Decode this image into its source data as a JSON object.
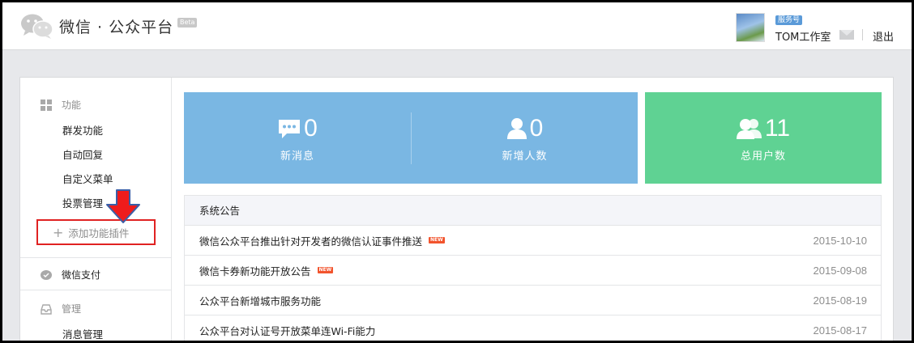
{
  "header": {
    "logo_text": "微信 · 公众平台",
    "beta_label": "Beta",
    "account_badge": "服务号",
    "account_name": "TOM工作室",
    "logout_label": "退出"
  },
  "sidebar": {
    "sections": [
      {
        "label": "功能",
        "icon": "grid-icon"
      },
      {
        "label": "微信支付",
        "icon": "wechat-pay-icon"
      },
      {
        "label": "管理",
        "icon": "inbox-icon"
      }
    ],
    "function_items": [
      "群发功能",
      "自动回复",
      "自定义菜单",
      "投票管理"
    ],
    "add_plugin_label": "添加功能插件",
    "manage_items": [
      "消息管理"
    ]
  },
  "stats": [
    {
      "value": "0",
      "label": "新消息",
      "icon": "message-icon"
    },
    {
      "value": "0",
      "label": "新增人数",
      "icon": "user-icon"
    },
    {
      "value": "11",
      "label": "总用户数",
      "icon": "users-icon"
    }
  ],
  "colors": {
    "stat_blue": "#7ab7e3",
    "stat_green": "#5fd293",
    "highlight_red": "#e02222",
    "new_badge": "#f2542d"
  },
  "notices": {
    "title": "系统公告",
    "items": [
      {
        "title": "微信公众平台推出针对开发者的微信认证事件推送",
        "is_new": true,
        "new_label": "NEW",
        "date": "2015-10-10"
      },
      {
        "title": "微信卡券新功能开放公告",
        "is_new": true,
        "new_label": "NEW",
        "date": "2015-09-08"
      },
      {
        "title": "公众平台新增城市服务功能",
        "is_new": false,
        "new_label": "",
        "date": "2015-08-19"
      },
      {
        "title": "公众平台对认证号开放菜单连Wi-Fi能力",
        "is_new": false,
        "new_label": "",
        "date": "2015-08-17"
      }
    ]
  }
}
